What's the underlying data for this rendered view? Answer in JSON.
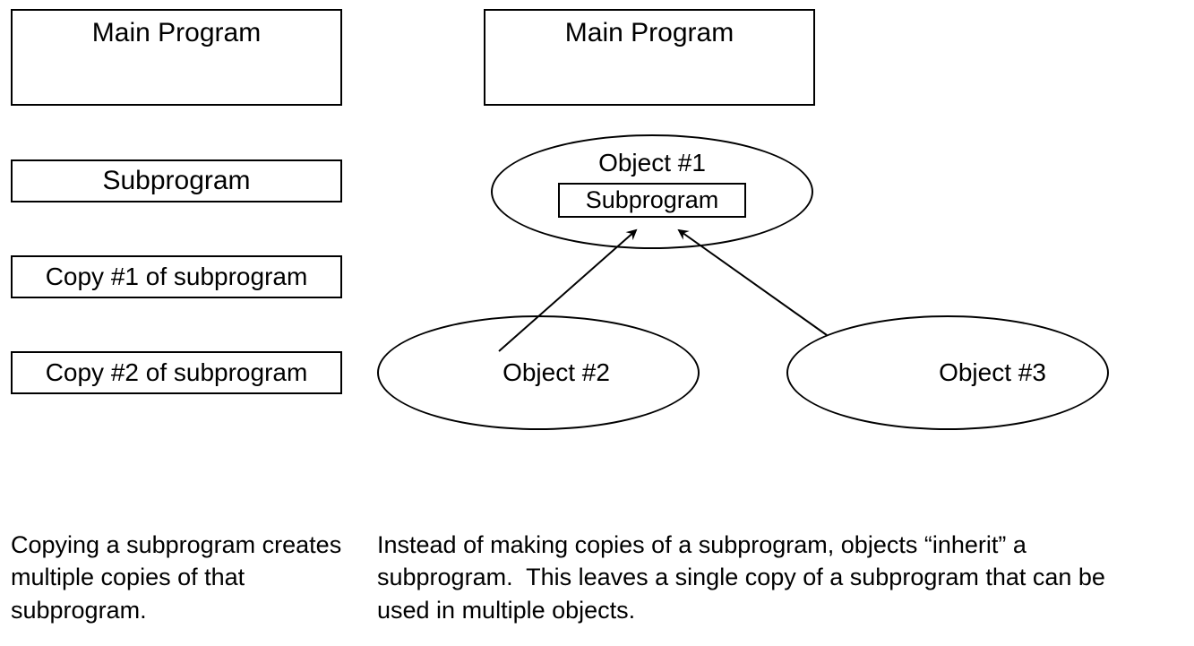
{
  "left": {
    "main": "Main Program",
    "sub": "Subprogram",
    "copy1": "Copy #1 of subprogram",
    "copy2": "Copy #2 of subprogram",
    "caption": "Copying a subprogram creates multiple copies of that subprogram."
  },
  "right": {
    "main": "Main Program",
    "object1": "Object #1",
    "subprogram": "Subprogram",
    "object2": "Object #2",
    "object3": "Object #3",
    "caption": "Instead of making copies of a subprogram, objects “inherit” a subprogram.  This leaves a single copy of a subprogram that can be used in multiple objects."
  }
}
